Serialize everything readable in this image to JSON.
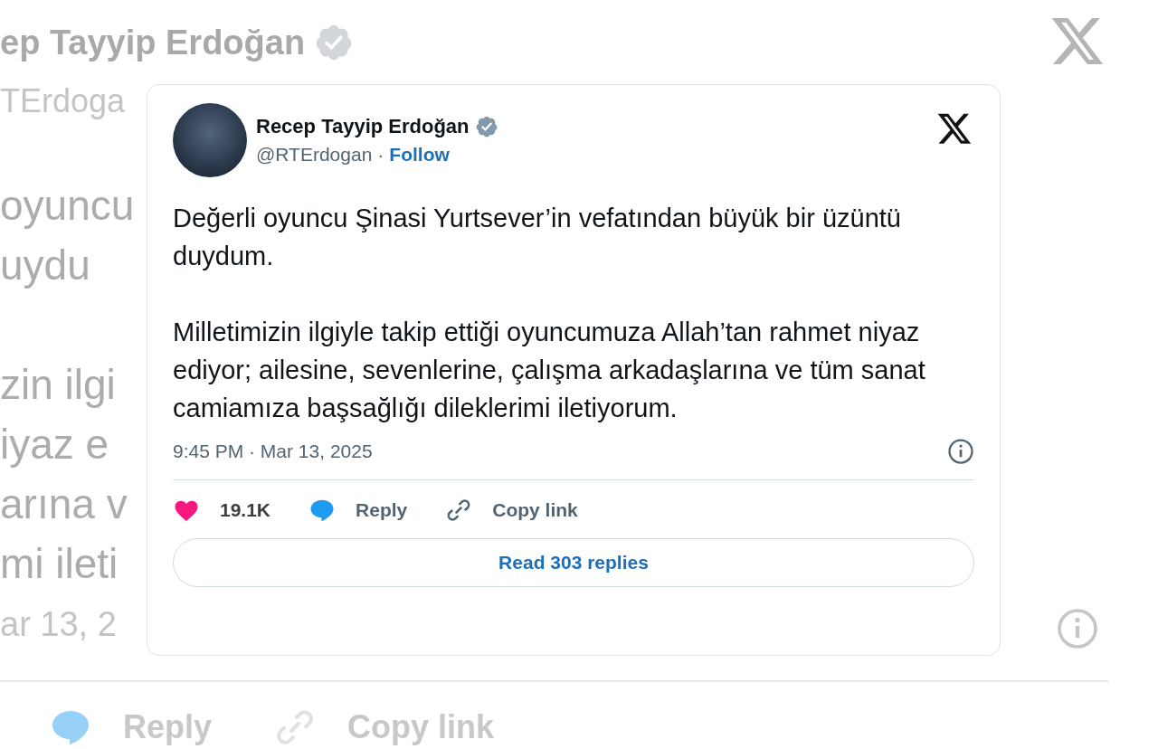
{
  "background": {
    "name": "ep Tayyip Erdoğan",
    "verified": true,
    "handle": "TErdoga",
    "body_paragraphs": [
      [
        "oyuncu",
        "uydu"
      ],
      [
        "zin ilgi",
        "iyaz e",
        "arına v",
        "mi ileti"
      ]
    ],
    "date": "ar 13, 2",
    "actions": [
      {
        "kind": "reply",
        "label": "Reply"
      },
      {
        "kind": "copy",
        "label": "Copy link"
      }
    ]
  },
  "tweet": {
    "name": "Recep Tayyip Erdoğan",
    "verified": true,
    "handle": "@RTErdogan",
    "separator": "·",
    "follow": "Follow",
    "paragraphs": [
      "Değerli oyuncu Şinasi Yurtsever’in vefatından büyük bir üzüntü duydum.",
      "Milletimizin ilgiyle takip ettiği oyuncumuza Allah’tan rahmet niyaz ediyor; ailesine, sevenlerine, çalışma arkadaşlarına ve tüm sanat camiamıza başsağlığı dileklerimi iletiyorum."
    ],
    "timestamp": "9:45 PM · Mar 13, 2025",
    "actions": [
      {
        "kind": "like",
        "label": "19.1K"
      },
      {
        "kind": "reply",
        "label": "Reply"
      },
      {
        "kind": "copy",
        "label": "Copy link"
      }
    ],
    "read_replies": "Read 303 replies"
  }
}
